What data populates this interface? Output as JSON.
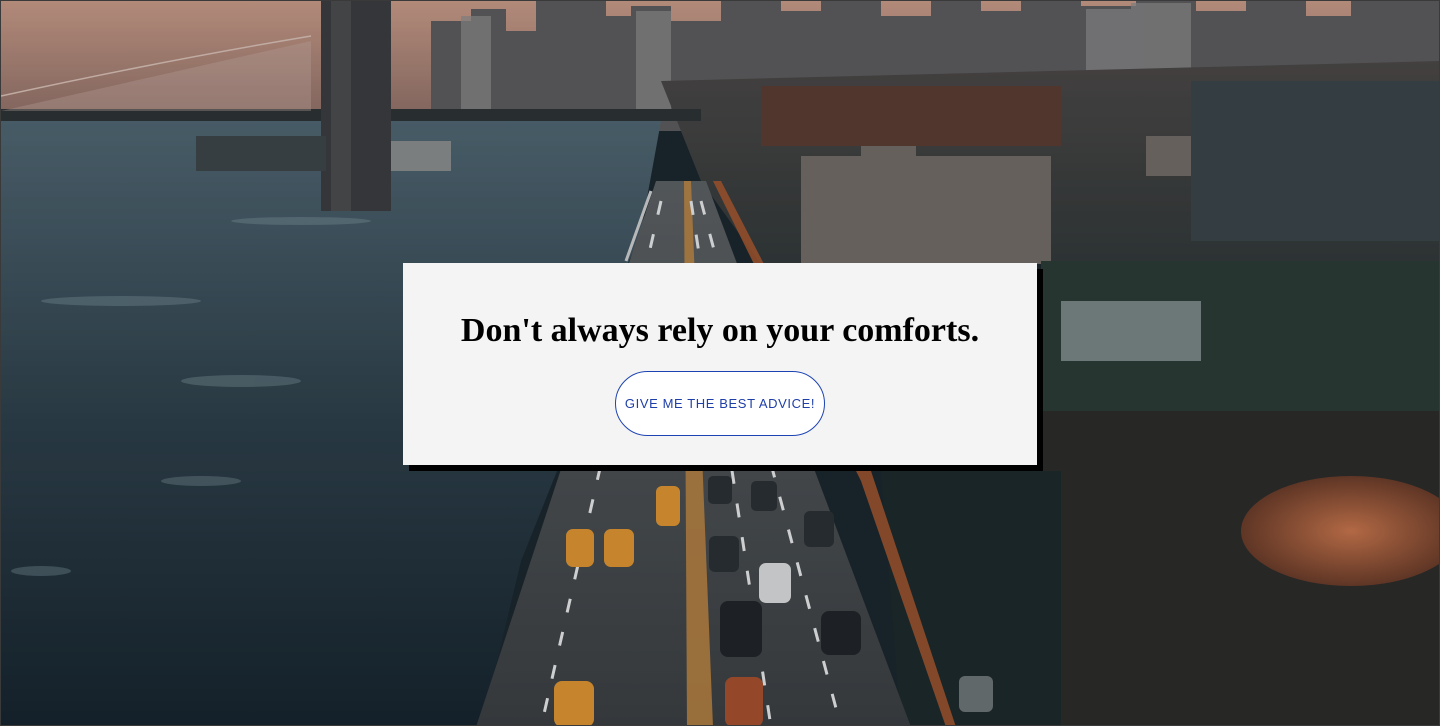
{
  "advice": {
    "quote": "Don't always rely on your comforts.",
    "button_label": "GIVE ME THE BEST ADVICE!"
  },
  "background": {
    "icon": "city-bridge-photo"
  },
  "colors": {
    "card_background": "#f4f4f4",
    "card_shadow": "#000000",
    "button_border": "#1e44b3",
    "button_text": "#1e3ea8",
    "quote_text": "#000000"
  }
}
